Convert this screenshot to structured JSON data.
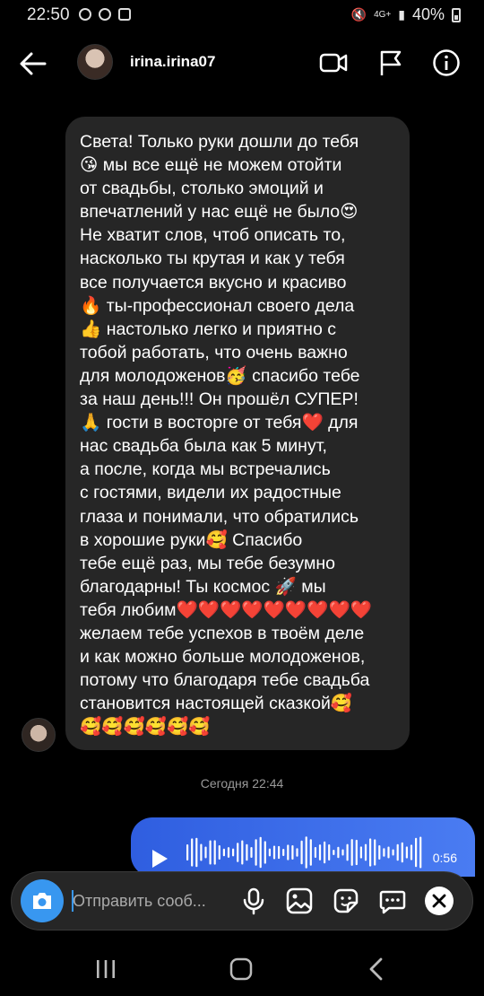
{
  "status": {
    "time": "22:50",
    "battery": "40%",
    "network": "4G+"
  },
  "header": {
    "username": "irina.irina07"
  },
  "message": {
    "text": "Света! Только руки дошли до тебя\n😘 мы все ещё не можем отойти\nот свадьбы, столько эмоций и\nвпечатлений у нас ещё не было😍\nНе хватит слов, чтоб описать то,\nнасколько ты крутая и как у тебя\nвсе получается вкусно и красиво\n🔥 ты-профессионал своего дела\n👍 настолько легко и приятно с\nтобой работать, что очень важно\nдля молодоженов🥳 спасибо тебе\nза наш день!!! Он прошёл СУПЕР!\n🙏 гости в восторге от тебя❤️ для\nнас свадьба была как 5 минут,\nа после, когда мы встречались\nс гостями, видели их радостные\nглаза и понимали, что обратились\nв хорошие руки🥰 Спасибо\nтебе ещё раз, мы тебе безумно\nблагодарны! Ты космос 🚀 мы\nтебя любим❤️❤️❤️❤️❤️❤️❤️❤️❤️\nжелаем тебе успехов в твоём деле\nи как можно больше молодоженов,\nпотому что благодаря тебе свадьба\nстановится настоящей сказкой🥰\n🥰🥰🥰🥰🥰🥰"
  },
  "timestamp": "Сегодня 22:44",
  "voice": {
    "duration": "0:56"
  },
  "composer": {
    "placeholder": "Отправить сооб..."
  },
  "colors": {
    "accent": "#3897f0",
    "voice_bubble": "#3b6de8",
    "incoming_bubble": "#262626"
  },
  "icons": [
    "back-arrow-icon",
    "video-call-icon",
    "flag-icon",
    "info-icon",
    "camera-icon",
    "microphone-icon",
    "gallery-icon",
    "sticker-icon",
    "more-options-icon",
    "close-icon",
    "recent-apps-icon",
    "home-icon",
    "back-icon"
  ]
}
